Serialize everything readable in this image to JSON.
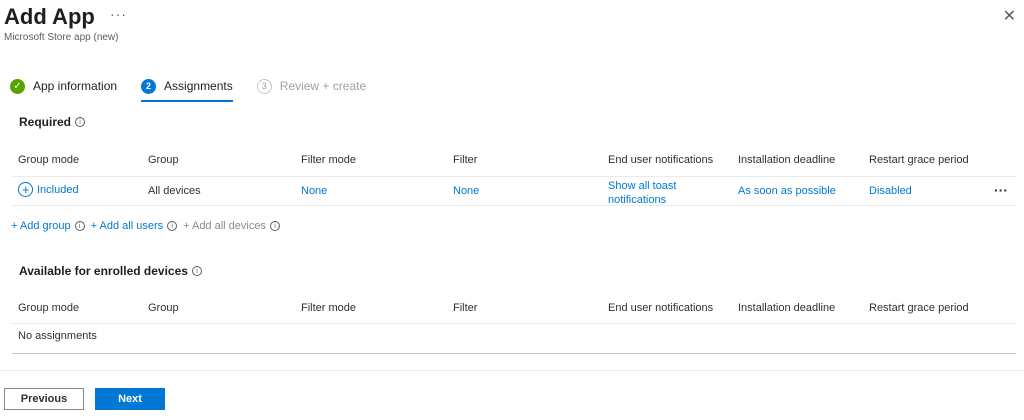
{
  "header": {
    "title": "Add App",
    "more_label": "···",
    "subtitle": "Microsoft Store app (new)",
    "close_label": "✕"
  },
  "steps": [
    {
      "number": "✓",
      "label": "App information",
      "state": "done"
    },
    {
      "number": "2",
      "label": "Assignments",
      "state": "active"
    },
    {
      "number": "3",
      "label": "Review + create",
      "state": "future"
    }
  ],
  "info_glyph": "i",
  "required": {
    "title": "Required",
    "columns": [
      "Group mode",
      "Group",
      "Filter mode",
      "Filter",
      "End user notifications",
      "Installation deadline",
      "Restart grace period"
    ],
    "row": {
      "group_mode": "Included",
      "group": "All devices",
      "filter_mode": "None",
      "filter": "None",
      "notifications_line1": "Show all toast",
      "notifications_line2": "notifications",
      "deadline": "As soon as possible",
      "restart": "Disabled",
      "more": "···"
    },
    "add_group": "+ Add group",
    "add_all_users": "+ Add all users",
    "add_all_devices": "+ Add all devices"
  },
  "available": {
    "title": "Available for enrolled devices",
    "columns": [
      "Group mode",
      "Group",
      "Filter mode",
      "Filter",
      "End user notifications",
      "Installation deadline",
      "Restart grace period"
    ],
    "empty": "No assignments"
  },
  "footer": {
    "previous": "Previous",
    "next": "Next"
  },
  "colors": {
    "accent": "#0078d4",
    "success": "#57a300"
  }
}
